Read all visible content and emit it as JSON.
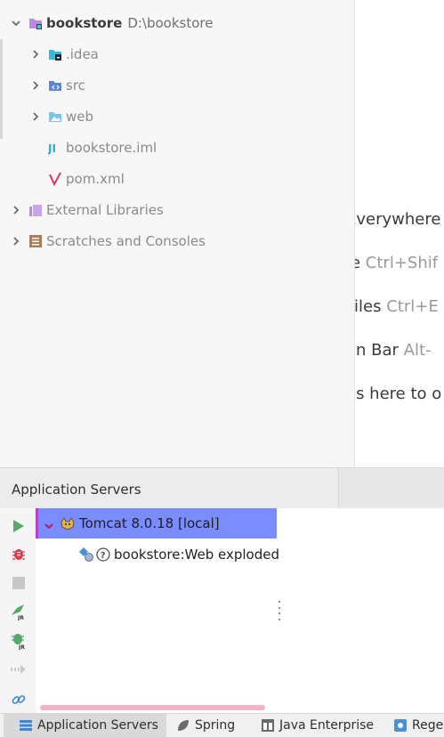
{
  "project_tree": {
    "root": {
      "name": "bookstore",
      "path": "D:\\bookstore"
    },
    "children": [
      {
        "label": ".idea"
      },
      {
        "label": "src"
      },
      {
        "label": "web"
      },
      {
        "label": "bookstore.iml"
      },
      {
        "label": "pom.xml"
      }
    ],
    "external_libraries": "External Libraries",
    "scratches": "Scratches and Consoles"
  },
  "editor_hints": [
    {
      "text": "Everywhere",
      "shortcut": ""
    },
    {
      "text": "le ",
      "shortcut": "Ctrl+Shif"
    },
    {
      "text": "Files ",
      "shortcut": "Ctrl+E"
    },
    {
      "text": "on Bar ",
      "shortcut": "Alt-"
    },
    {
      "text": "es here to o",
      "shortcut": ""
    }
  ],
  "tool_window": {
    "title": "Application Servers",
    "server": "Tomcat 8.0.18 [local]",
    "artifact": "bookstore:Web exploded"
  },
  "bottom_tabs": [
    {
      "label": "Application Servers"
    },
    {
      "label": "Spring"
    },
    {
      "label": "Java Enterprise"
    },
    {
      "label": "Rege"
    }
  ],
  "colors": {
    "selection": "#7b8cff",
    "selection_edge": "#b13fd0",
    "run_green": "#59a869",
    "debug_red": "#db3b4b",
    "progress_pink": "#f3b3c9"
  }
}
